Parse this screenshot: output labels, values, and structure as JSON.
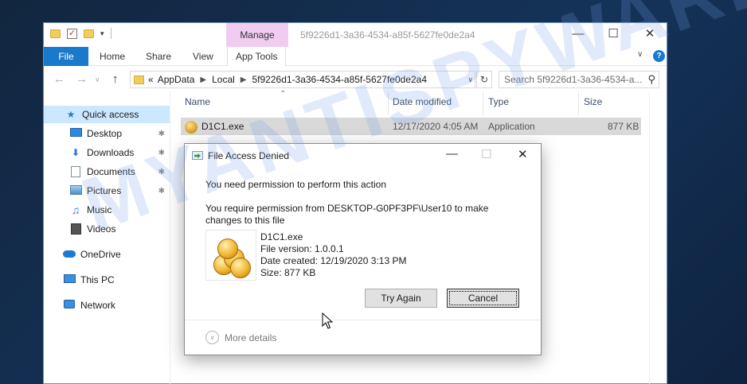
{
  "window": {
    "title": "5f9226d1-3a36-4534-a85f-5627fe0de2a4",
    "manage_tab": "Manage"
  },
  "ribbon": {
    "tabs": [
      "File",
      "Home",
      "Share",
      "View",
      "App Tools"
    ]
  },
  "address": {
    "prefix": "«",
    "crumbs": [
      "AppData",
      "Local",
      "5f9226d1-3a36-4534-a85f-5627fe0de2a4"
    ]
  },
  "search": {
    "placeholder": "Search 5f9226d1-3a36-4534-a..."
  },
  "nav": {
    "items": [
      {
        "label": "Quick access",
        "icon": "star-icon",
        "pinned": false
      },
      {
        "label": "Desktop",
        "icon": "desktop-icon",
        "pinned": true
      },
      {
        "label": "Downloads",
        "icon": "download-icon",
        "pinned": true
      },
      {
        "label": "Documents",
        "icon": "documents-icon",
        "pinned": true
      },
      {
        "label": "Pictures",
        "icon": "pictures-icon",
        "pinned": true
      },
      {
        "label": "Music",
        "icon": "music-icon",
        "pinned": false
      },
      {
        "label": "Videos",
        "icon": "videos-icon",
        "pinned": false
      },
      {
        "label": "OneDrive",
        "icon": "cloud-icon",
        "pinned": false
      },
      {
        "label": "This PC",
        "icon": "computer-icon",
        "pinned": false
      },
      {
        "label": "Network",
        "icon": "network-icon",
        "pinned": false
      }
    ]
  },
  "columns": [
    "Name",
    "Date modified",
    "Type",
    "Size"
  ],
  "files": [
    {
      "name": "D1C1.exe",
      "date": "12/17/2020 4:05 AM",
      "type": "Application",
      "size": "877 KB"
    }
  ],
  "dialog": {
    "title": "File Access Denied",
    "heading": "You need permission to perform this action",
    "body": "You require permission from DESKTOP-G0PF3PF\\User10 to make changes to this file",
    "file_name": "D1C1.exe",
    "file_version": "File version: 1.0.0.1",
    "date_created": "Date created: 12/19/2020 3:13 PM",
    "size": "Size: 877 KB",
    "try_again": "Try Again",
    "cancel": "Cancel",
    "more_details": "More details"
  },
  "watermark": "MYANTISPYWARE.COM",
  "colors": {
    "accent": "#1979ca",
    "manage_tab": "#f0cdf0",
    "selection": "#cce8ff",
    "row_highlight": "#d9d9d9"
  }
}
